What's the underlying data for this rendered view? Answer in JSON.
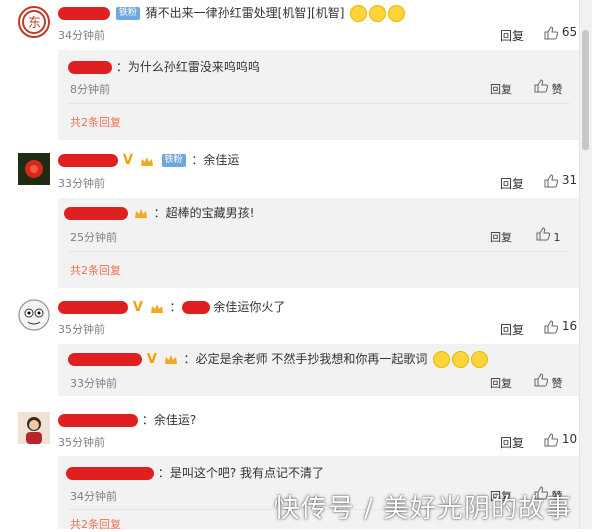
{
  "comments": [
    {
      "badge": "铁粉",
      "text": "猜不出来一律孙红雷处理[机智][机智]",
      "time": "34分钟前",
      "reply_label": "回复",
      "likes": "65",
      "reply": {
        "text": "为什么孙红雷没来呜呜呜",
        "time": "8分钟前",
        "reply_label": "回复",
        "likes": "赞"
      },
      "more": "共2条回复"
    },
    {
      "badge": "铁粉",
      "text": "余佳运",
      "time": "33分钟前",
      "reply_label": "回复",
      "likes": "31",
      "reply": {
        "text": "超棒的宝藏男孩!",
        "time": "25分钟前",
        "reply_label": "回复",
        "likes": "1"
      },
      "more": "共2条回复"
    },
    {
      "text": "余佳运你火了",
      "time": "35分钟前",
      "reply_label": "回复",
      "likes": "16",
      "reply": {
        "text": "必定是余老师 不然手抄我想和你再一起歌词",
        "time": "33分钟前",
        "reply_label": "回复",
        "likes": "赞"
      }
    },
    {
      "text": "余佳运?",
      "time": "35分钟前",
      "reply_label": "回复",
      "likes": "10",
      "reply": {
        "text": "是叫这个吧? 我有点记不清了",
        "time": "34分钟前",
        "reply_label": "回复",
        "likes": "赞"
      },
      "more": "共2条回复"
    }
  ],
  "colors": {
    "link": "#eb7350",
    "redaction": "#e02020",
    "reply_bg": "#f2f2f2",
    "time": "#808080"
  },
  "watermark": "快传号 / 美好光阴的故事"
}
